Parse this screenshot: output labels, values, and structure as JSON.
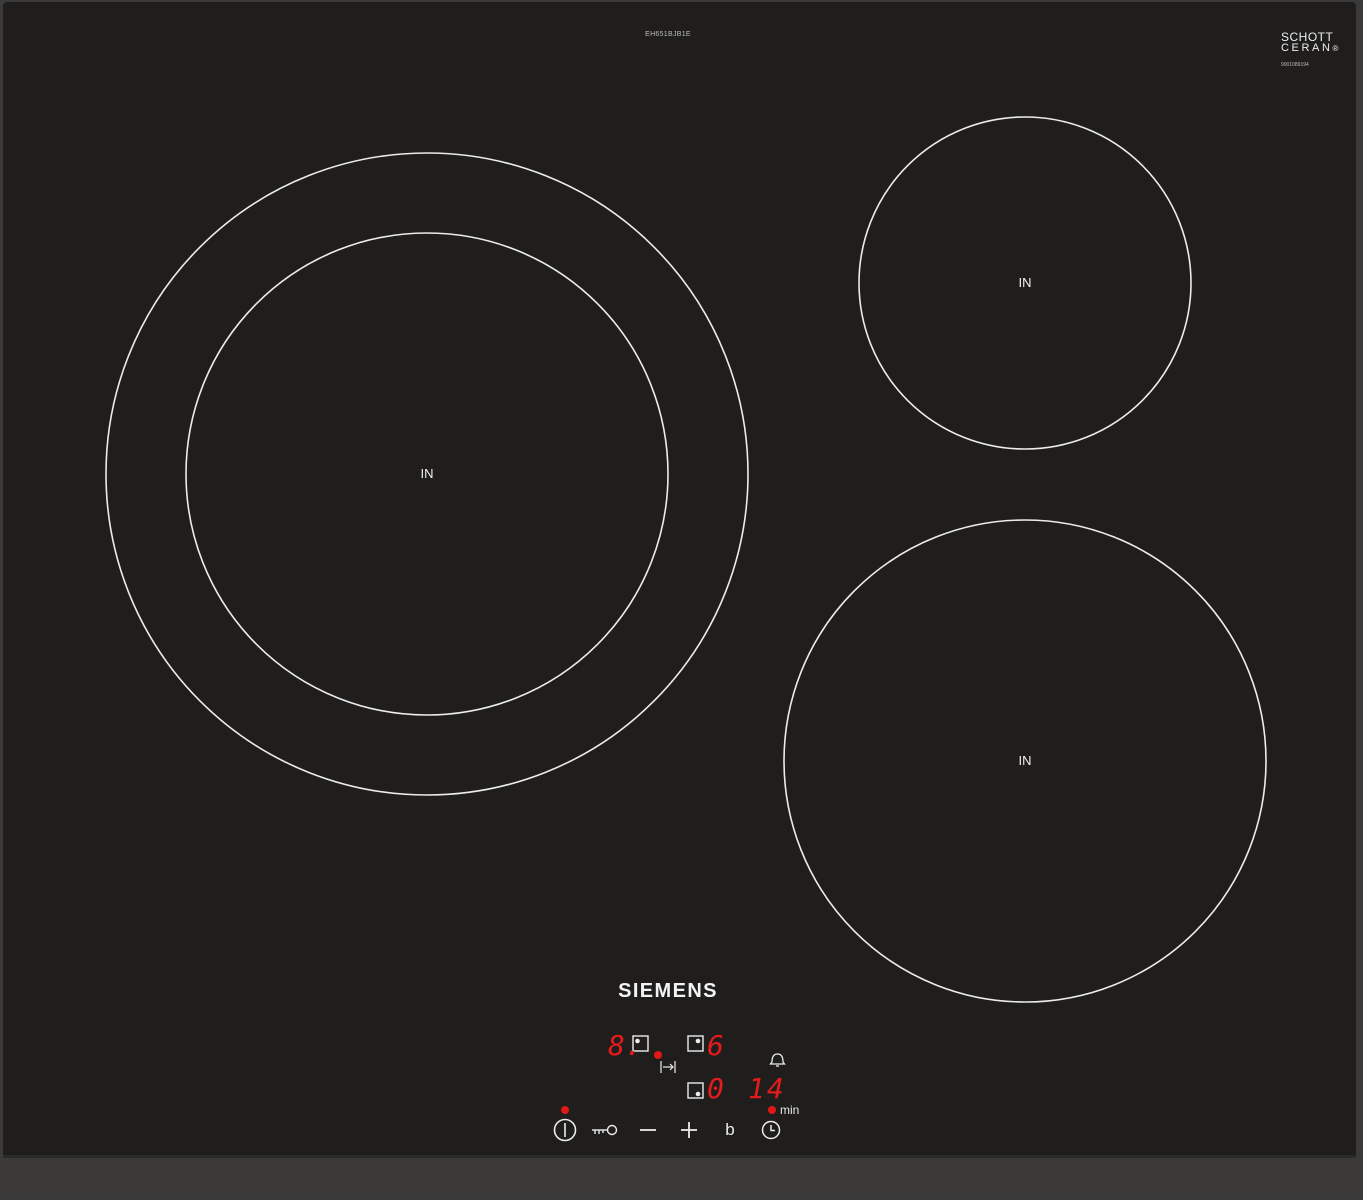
{
  "hob": {
    "brand": "SIEMENS",
    "model": "EH651BJB1E",
    "glass_brand_line1": "SCHOTT",
    "glass_brand_line2": "CERAN",
    "glass_registered_mark": "®",
    "serial": "9001089194",
    "colors": {
      "glass": "#1f1e1d",
      "frame": "#3c3c3c",
      "ring": "#ececec",
      "display_red": "#e41b1b"
    }
  },
  "zones": [
    {
      "label": "IN"
    },
    {
      "label": "IN"
    },
    {
      "label": "IN"
    }
  ],
  "display": {
    "left_power": "8.",
    "right_power": "6",
    "timer_zone": "0",
    "timer_minutes": "14",
    "minutes_unit": "min"
  },
  "controls": [
    {
      "icon": "power-icon"
    },
    {
      "icon": "key-lock-icon"
    },
    {
      "icon": "minus-icon"
    },
    {
      "icon": "plus-icon"
    },
    {
      "icon": "boost-icon",
      "label": "b"
    },
    {
      "icon": "timer-icon"
    }
  ],
  "status_icons": [
    "front-left-zone-icon",
    "front-right-zone-icon",
    "rear-right-zone-icon",
    "extended-zone-icon",
    "bell-icon"
  ]
}
